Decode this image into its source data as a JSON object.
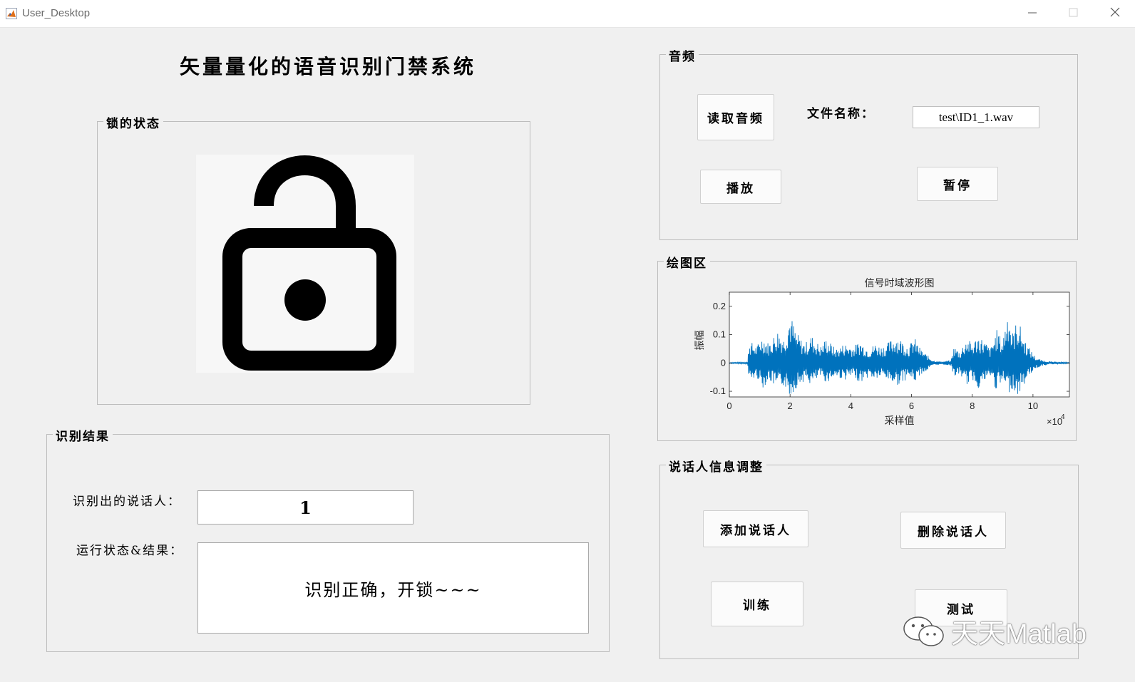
{
  "window": {
    "title": "User_Desktop",
    "icons": [
      "matlab-icon",
      "minimize-icon",
      "maximize-icon",
      "close-icon"
    ]
  },
  "main_title": "矢量量化的语音识别门禁系统",
  "lock_panel": {
    "title": "锁的状态",
    "icon": "unlocked-padlock-icon"
  },
  "audio_panel": {
    "title": "音频",
    "read_button": "读取音频",
    "filename_label": "文件名称：",
    "filename_value": "test\\ID1_1.wav",
    "play_button": "播放",
    "pause_button": "暂停"
  },
  "plot_panel": {
    "title": "绘图区"
  },
  "result_panel": {
    "title": "识别结果",
    "speaker_label": "识别出的说话人：",
    "speaker_value": "1",
    "status_label": "运行状态&结果：",
    "status_value": "识别正确，开锁~~~"
  },
  "speaker_panel": {
    "title": "说话人信息调整",
    "add_button": "添加说话人",
    "delete_button": "删除说话人",
    "train_button": "训练",
    "test_button": "测试"
  },
  "watermark": {
    "text": "天天Matlab",
    "icon": "wechat-icon"
  },
  "colors": {
    "background": "#f0f0f0",
    "waveform": "#0072bd",
    "border": "#bdbdbd"
  },
  "chart_data": {
    "type": "line",
    "title": "信号时域波形图",
    "xlabel": "采样值",
    "ylabel": "振幅",
    "x_exponent_label": "×10",
    "x_exponent_power": "4",
    "xlim": [
      0,
      11.2
    ],
    "ylim": [
      -0.12,
      0.25
    ],
    "xticks": [
      0,
      2,
      4,
      6,
      8,
      10
    ],
    "xtick_labels": [
      "0",
      "2",
      "4",
      "6",
      "8",
      "10"
    ],
    "yticks": [
      -0.1,
      0,
      0.1,
      0.2
    ],
    "ytick_labels": [
      "-0.1",
      "0",
      "0.1",
      "0.2"
    ],
    "grid": false,
    "envelope": {
      "x": [
        0,
        0.6,
        0.65,
        0.9,
        1.1,
        1.3,
        1.6,
        1.8,
        2.0,
        2.2,
        2.4,
        2.5,
        2.7,
        3.0,
        3.2,
        3.5,
        3.8,
        4.1,
        4.3,
        4.6,
        4.8,
        5.0,
        5.2,
        5.5,
        5.7,
        5.9,
        6.1,
        6.3,
        6.5,
        6.7,
        7.0,
        7.3,
        7.4,
        7.6,
        7.8,
        8.0,
        8.2,
        8.4,
        8.6,
        8.8,
        9.0,
        9.2,
        9.3,
        9.5,
        9.7,
        9.9,
        10.1,
        10.3,
        10.6,
        11.0,
        11.2
      ],
      "upper": [
        0.002,
        0.003,
        0.08,
        0.06,
        0.1,
        0.07,
        0.12,
        0.09,
        0.18,
        0.11,
        0.08,
        0.07,
        0.1,
        0.06,
        0.09,
        0.05,
        0.07,
        0.06,
        0.08,
        0.05,
        0.07,
        0.06,
        0.07,
        0.1,
        0.08,
        0.06,
        0.09,
        0.05,
        0.03,
        0.01,
        0.005,
        0.01,
        0.06,
        0.04,
        0.09,
        0.07,
        0.1,
        0.08,
        0.05,
        0.12,
        0.08,
        0.22,
        0.1,
        0.16,
        0.09,
        0.05,
        0.02,
        0.01,
        0.005,
        0.003,
        0.002
      ],
      "lower": [
        -0.002,
        -0.003,
        -0.07,
        -0.05,
        -0.09,
        -0.06,
        -0.1,
        -0.08,
        -0.12,
        -0.09,
        -0.07,
        -0.06,
        -0.08,
        -0.05,
        -0.07,
        -0.05,
        -0.06,
        -0.05,
        -0.07,
        -0.05,
        -0.06,
        -0.05,
        -0.06,
        -0.08,
        -0.07,
        -0.05,
        -0.07,
        -0.04,
        -0.03,
        -0.01,
        -0.005,
        -0.01,
        -0.05,
        -0.04,
        -0.08,
        -0.06,
        -0.09,
        -0.07,
        -0.05,
        -0.1,
        -0.07,
        -0.11,
        -0.09,
        -0.12,
        -0.08,
        -0.04,
        -0.02,
        -0.01,
        -0.005,
        -0.003,
        -0.002
      ]
    }
  }
}
